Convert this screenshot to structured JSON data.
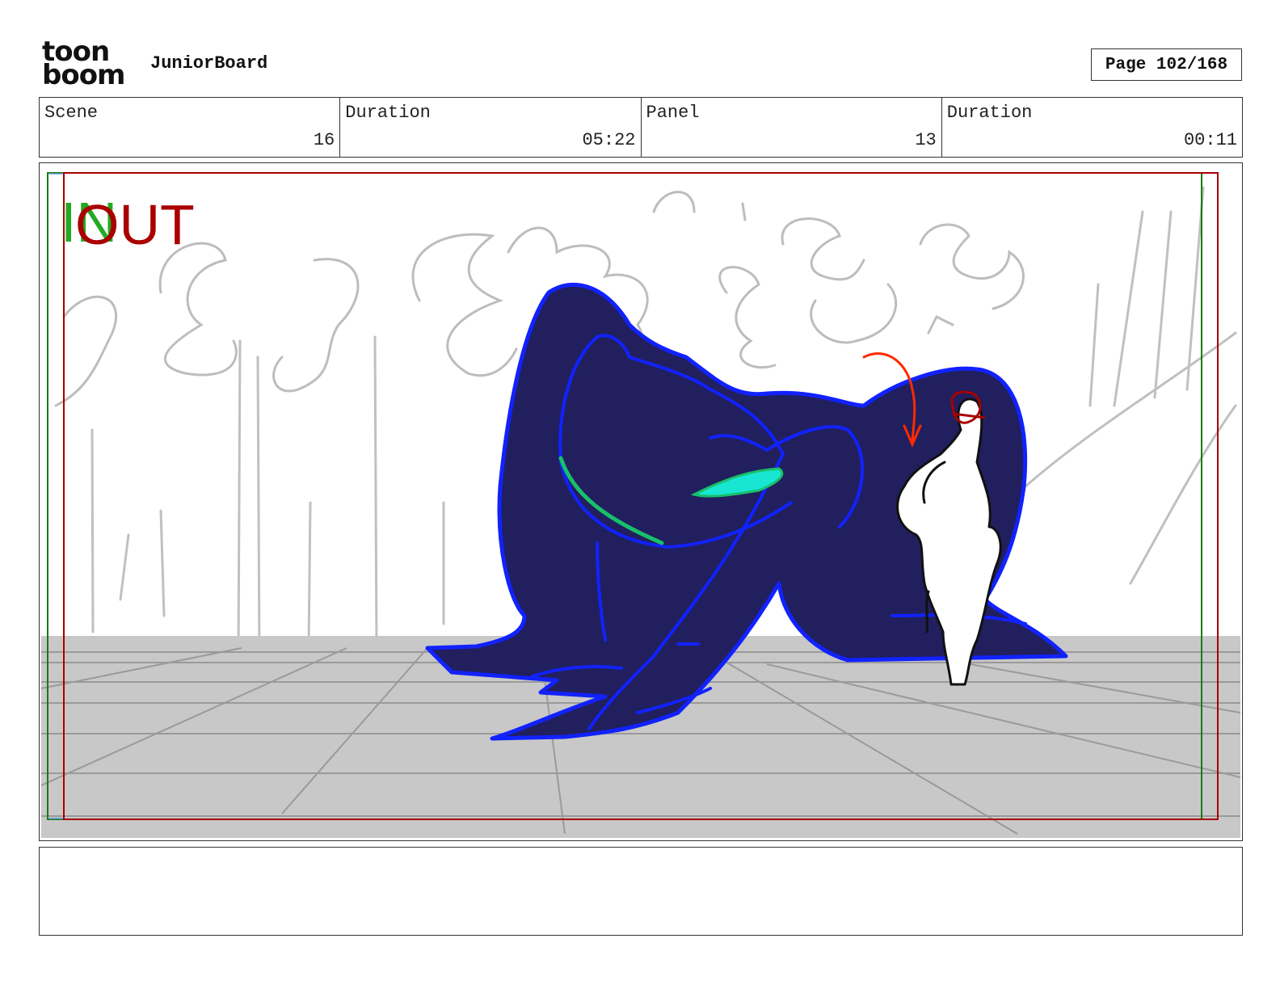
{
  "header": {
    "logo_top": "toon",
    "logo_bottom": "boom",
    "app_name": "JuniorBoard",
    "page_label": "Page 102/168"
  },
  "info": [
    {
      "label": "Scene",
      "value": "16"
    },
    {
      "label": "Duration",
      "value": "05:22"
    },
    {
      "label": "Panel",
      "value": "13"
    },
    {
      "label": "Duration",
      "value": "00:11"
    }
  ],
  "panel": {
    "in_label": "IN",
    "out_label": "OUT",
    "colors": {
      "in_green": "#22aa22",
      "out_red": "#aa0000",
      "creature_fill": "#211f5e",
      "creature_stroke": "#1122ff",
      "floor": "#c8c8c8",
      "highlight_cyan": "#19e6d2",
      "highlight_green": "#18c06a"
    }
  },
  "notes": {
    "text": ""
  }
}
